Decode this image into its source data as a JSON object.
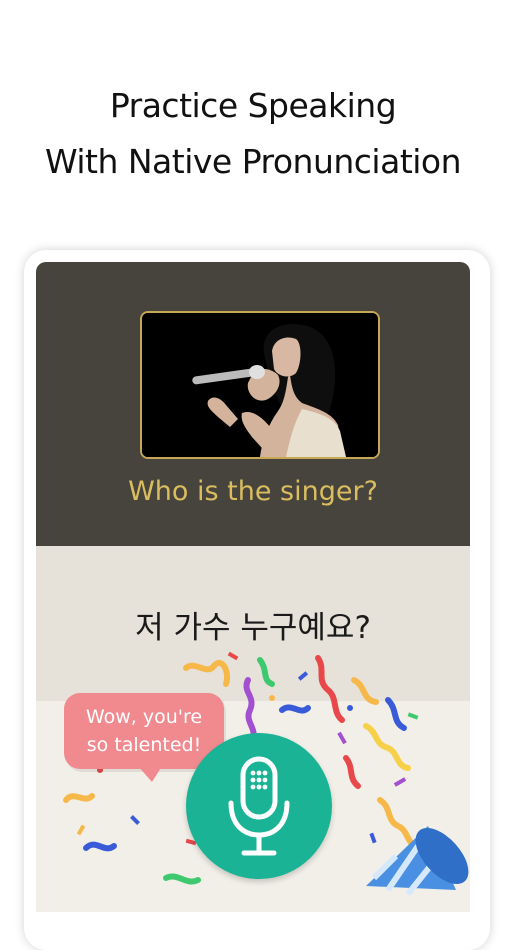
{
  "headline": {
    "line1": "Practice Speaking",
    "line2": "With Native Pronunciation"
  },
  "lesson": {
    "question_en": "Who is the singer?",
    "sentence_ko": "저 가수 누구예요?"
  },
  "feedback_bubble": {
    "line1": "Wow, you're",
    "line2": "so talented!"
  },
  "icons": {
    "mic": "microphone-icon",
    "party": "party-popper-icon"
  },
  "colors": {
    "panel_dark": "#47443e",
    "gold": "#d9bd5e",
    "mic_green": "#1bb395",
    "bubble_pink": "#f08a8f"
  }
}
